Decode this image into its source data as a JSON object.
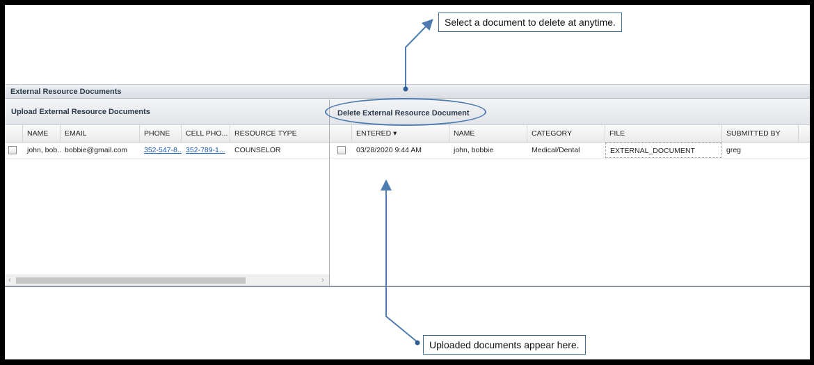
{
  "panel": {
    "title": "External Resource Documents"
  },
  "upload": {
    "header": "Upload External Resource Documents",
    "columns": [
      "NAME",
      "EMAIL",
      "PHONE",
      "CELL PHO...",
      "RESOURCE TYPE"
    ],
    "rows": [
      {
        "name": "john, bob...",
        "email": "bobbie@gmail.com",
        "phone": "352-547-8...",
        "cell": "352-789-1...",
        "type": "COUNSELOR"
      }
    ],
    "scroll_left": "‹",
    "scroll_right": "›"
  },
  "delete": {
    "header": "Delete External Resource Document",
    "columns": [
      "ENTERED ▾",
      "NAME",
      "CATEGORY",
      "FILE",
      "SUBMITTED BY"
    ],
    "rows": [
      {
        "entered": "03/28/2020 9:44 AM",
        "name": "john, bobbie",
        "category": "Medical/Dental",
        "file": "EXTERNAL_DOCUMENT",
        "submitted_by": "greg"
      }
    ]
  },
  "annotations": {
    "top": "Select a document to delete at anytime.",
    "bottom": "Uploaded documents appear here."
  },
  "colors": {
    "accent": "#4d7bb0",
    "link": "#1a5bb8"
  }
}
